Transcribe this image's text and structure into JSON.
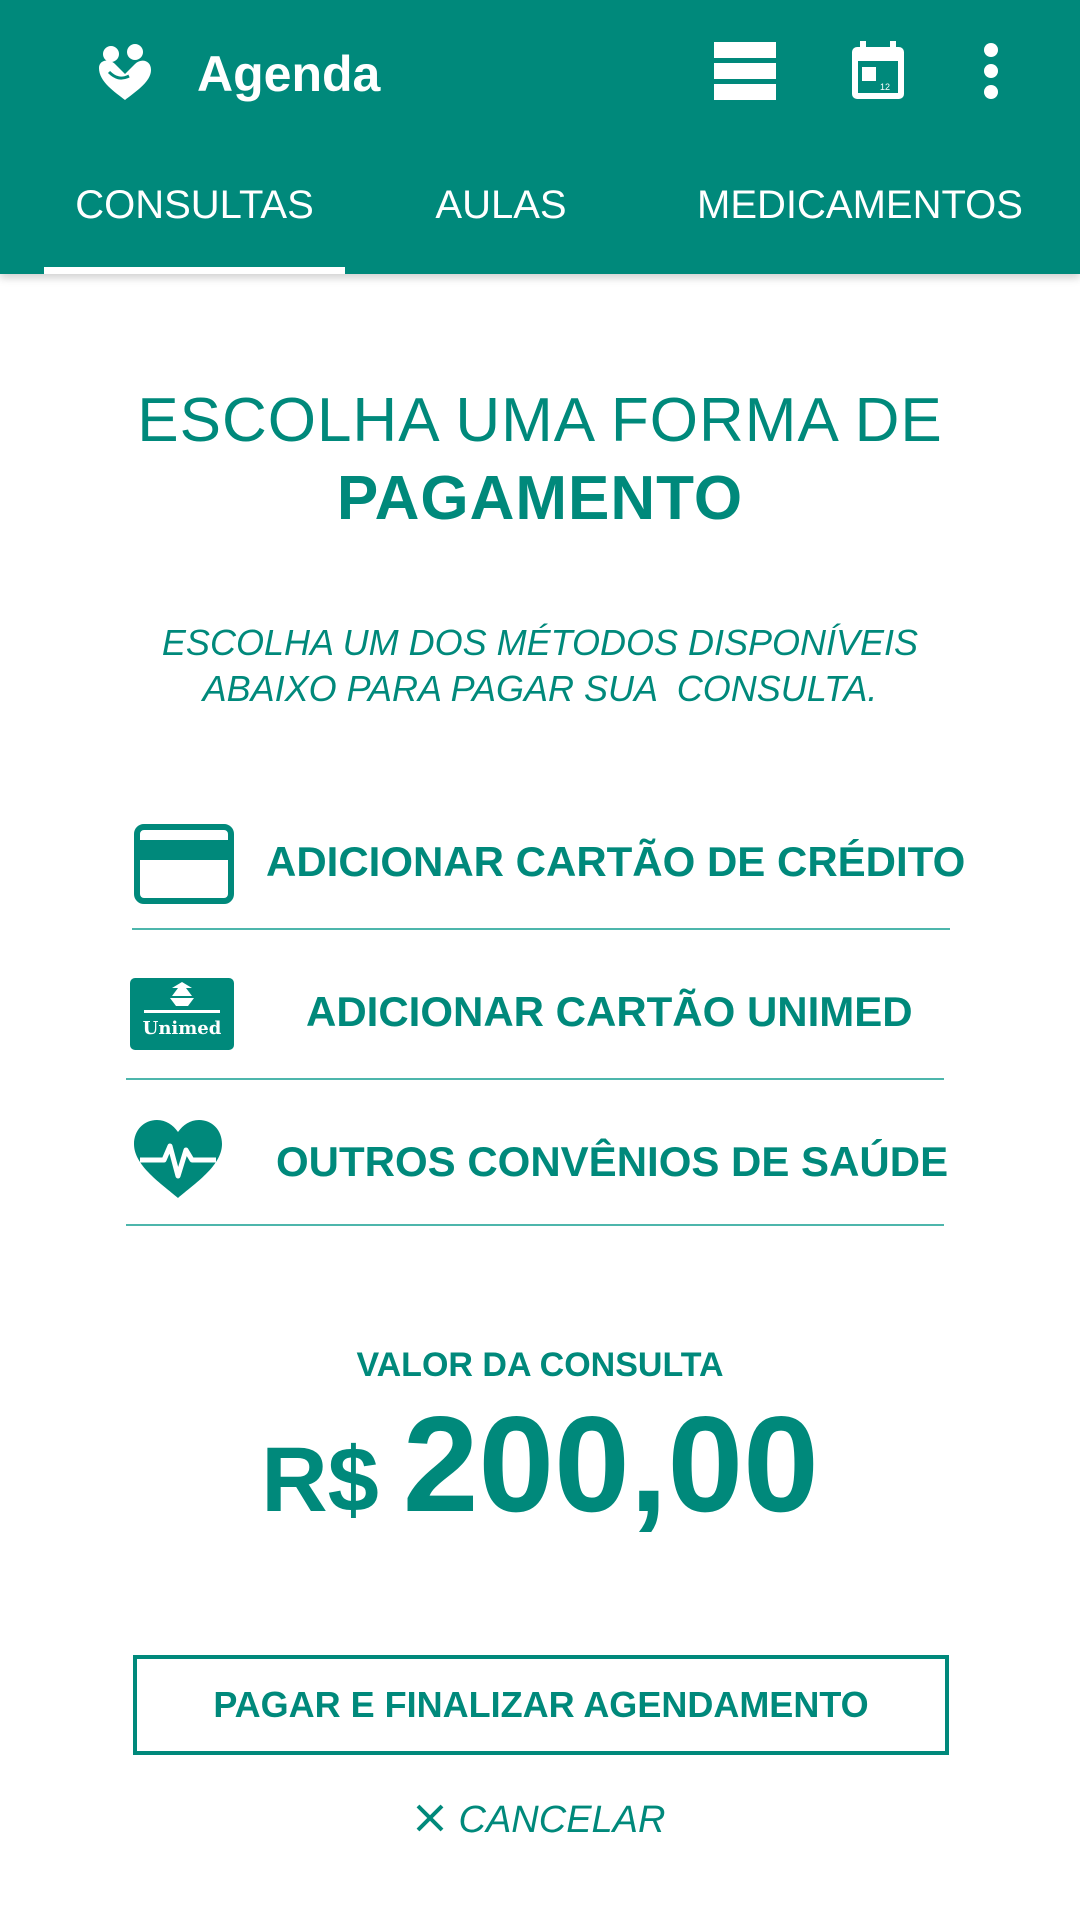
{
  "header": {
    "title": "Agenda",
    "icons": {
      "logo": "heart-people-icon",
      "list_view": "list-view-icon",
      "calendar": "calendar-icon",
      "calendar_day": "12",
      "more": "more-vert-icon"
    }
  },
  "tabs": [
    {
      "label": "CONSULTAS",
      "active": true
    },
    {
      "label": "AULAS",
      "active": false
    },
    {
      "label": "MEDICAMENTOS",
      "active": false
    }
  ],
  "main": {
    "heading_line1": "ESCOLHA UMA FORMA DE",
    "heading_line2": "PAGAMENTO",
    "subtitle_line1": "ESCOLHA UM DOS MÉTODOS DISPONÍVEIS",
    "subtitle_line2": "ABAIXO PARA PAGAR SUA  CONSULTA.",
    "options": [
      {
        "label": "ADICIONAR CARTÃO DE CRÉDITO",
        "icon": "credit-card-icon"
      },
      {
        "label": "ADICIONAR CARTÃO UNIMED",
        "icon": "unimed-logo-icon",
        "logo_text": "Unimed"
      },
      {
        "label": "OUTROS CONVÊNIOS DE SAÚDE",
        "icon": "heart-pulse-icon"
      }
    ],
    "value_label": "VALOR DA CONSULTA",
    "currency": "R$",
    "amount": "200,00",
    "pay_button": "PAGAR E FINALIZAR AGENDAMENTO",
    "cancel_label": "CANCELAR"
  },
  "colors": {
    "primary": "#00897b",
    "divider": "#4db6ac",
    "on_primary": "#ffffff"
  }
}
